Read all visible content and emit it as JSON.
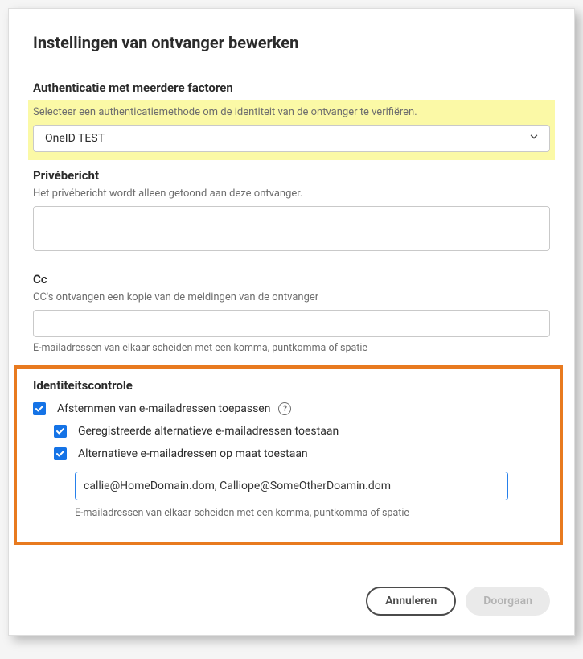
{
  "dialog": {
    "title": "Instellingen van ontvanger bewerken"
  },
  "auth": {
    "heading": "Authenticatie met meerdere factoren",
    "desc": "Selecteer een authenticatiemethode om de identiteit van de ontvanger te verifiëren.",
    "selected": "OneID TEST"
  },
  "privmsg": {
    "heading": "Privébericht",
    "desc": "Het privébericht wordt alleen getoond aan deze ontvanger.",
    "value": ""
  },
  "cc": {
    "heading": "Cc",
    "desc": "CC's ontvangen een kopie van de meldingen van de ontvanger",
    "value": "",
    "helper": "E-mailadressen van elkaar scheiden met een komma, puntkomma of spatie"
  },
  "identity": {
    "heading": "Identiteitscontrole",
    "enforce_label": "Afstemmen van e-mailadressen toepassen",
    "allow_registered_label": "Geregistreerde alternatieve e-mailadressen toestaan",
    "allow_custom_label": "Alternatieve e-mailadressen op maat toestaan",
    "custom_value": "callie@HomeDomain.dom, Calliope@SomeOtherDoamin.dom",
    "custom_helper": "E-mailadressen van elkaar scheiden met een komma, puntkomma of spatie"
  },
  "buttons": {
    "cancel": "Annuleren",
    "continue": "Doorgaan"
  }
}
